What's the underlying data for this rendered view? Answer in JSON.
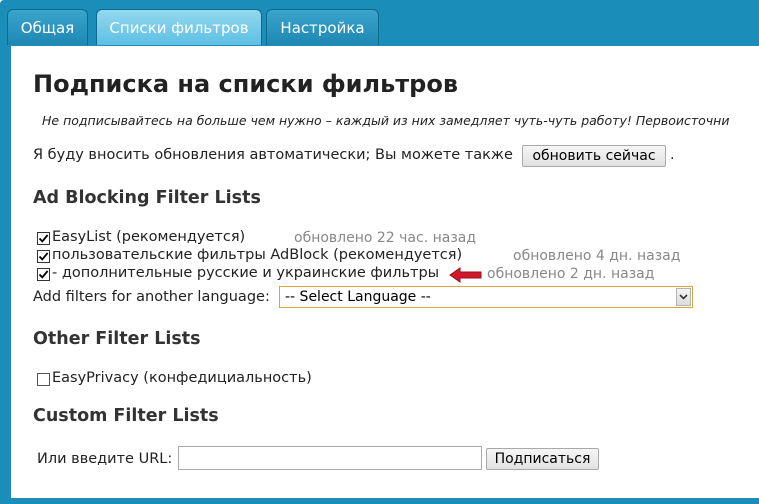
{
  "tabs": [
    {
      "label": "Общая",
      "active": false
    },
    {
      "label": "Списки фильтров",
      "active": true
    },
    {
      "label": "Настройка",
      "active": false
    }
  ],
  "page": {
    "title": "Подписка на списки фильтров",
    "note": "Не подписывайтесь на больше чем нужно – каждый из них замедляет чуть-чуть работу! Первоисточни",
    "auto_update_text": "Я буду вносить обновления автоматически; Вы можете также",
    "update_now_label": "обновить сейчас",
    "update_now_suffix": "."
  },
  "ad_blocking": {
    "heading": "Ad Blocking Filter Lists",
    "lists": [
      {
        "label": "EasyList (рекомендуется)",
        "checked": true,
        "updated": "обновлено 22 час. назад"
      },
      {
        "label": "пользовательские фильтры AdBlock (рекомендуется)",
        "checked": true,
        "updated": "обновлено 4 дн. назад"
      },
      {
        "label": "- дополнительные русские и украинские фильтры",
        "checked": true,
        "updated": "обновлено 2 дн. назад"
      }
    ],
    "language_label": "Add filters for another language:",
    "language_select_value": "-- Select Language --"
  },
  "other": {
    "heading": "Other Filter Lists",
    "lists": [
      {
        "label": "EasyPrivacy (конфедициальность)",
        "checked": false
      }
    ]
  },
  "custom": {
    "heading": "Custom Filter Lists",
    "url_label": "Или введите URL:",
    "url_value": "",
    "subscribe_label": "Подписаться"
  },
  "colors": {
    "frame": "#1a8db8",
    "tab_active": "#5dbfe3",
    "annotation_arrow": "#d0182a"
  },
  "icons": {
    "annotation": "red-arrow-left-icon",
    "dropdown": "chevron-down-icon",
    "checkmark": "checkmark-icon"
  }
}
